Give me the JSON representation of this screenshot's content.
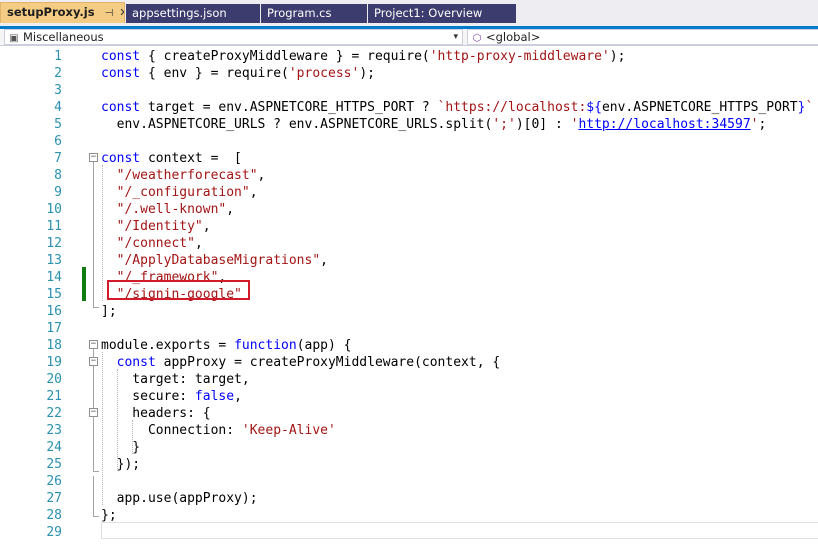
{
  "tabs": [
    {
      "label": "setupProxy.js",
      "active": true,
      "pin_icon": "pin-icon",
      "close_icon": "close-icon",
      "pin_glyph": "⊣",
      "close_glyph": "✕"
    },
    {
      "label": "appsettings.json",
      "active": false
    },
    {
      "label": "Program.cs",
      "active": false
    },
    {
      "label": "Project1: Overview",
      "active": false
    }
  ],
  "navbar": {
    "project": {
      "label": "Miscellaneous",
      "icon": "js-file-icon",
      "icon_glyph": "▣"
    },
    "scope": {
      "label": "<global>",
      "icon": "cube-icon",
      "icon_glyph": "⬡"
    },
    "arrow_glyph": "▾"
  },
  "editor": {
    "language": "javascript",
    "colors": {
      "keyword": "#0000ff",
      "string": "#a31515",
      "line_number": "#2b91af",
      "change_marker": "#107c10",
      "highlight_border": "#d11a2a",
      "active_tab": "#f5cc84"
    },
    "lines": [
      {
        "n": "1",
        "tokens": [
          {
            "t": "const",
            "c": "kw"
          },
          {
            "t": " { createProxyMiddleware } = require("
          },
          {
            "t": "'http-proxy-middleware'",
            "c": "str"
          },
          {
            "t": ");"
          }
        ]
      },
      {
        "n": "2",
        "tokens": [
          {
            "t": "const",
            "c": "kw"
          },
          {
            "t": " { env } = require("
          },
          {
            "t": "'process'",
            "c": "str"
          },
          {
            "t": ");"
          }
        ]
      },
      {
        "n": "3",
        "tokens": []
      },
      {
        "n": "4",
        "tokens": [
          {
            "t": "const",
            "c": "kw"
          },
          {
            "t": " target = env.ASPNETCORE_HTTPS_PORT ? "
          },
          {
            "t": "`https://localhost:",
            "c": "str"
          },
          {
            "t": "${",
            "c": "kw"
          },
          {
            "t": "env.ASPNETCORE_HTTPS_PORT"
          },
          {
            "t": "}",
            "c": "kw"
          },
          {
            "t": "`",
            "c": "str"
          },
          {
            "t": " :"
          }
        ]
      },
      {
        "n": "5",
        "tokens": [
          {
            "t": "  env.ASPNETCORE_URLS ? env.ASPNETCORE_URLS.split("
          },
          {
            "t": "';'",
            "c": "str"
          },
          {
            "t": ")[0] : "
          },
          {
            "t": "'",
            "c": "str"
          },
          {
            "t": "http://localhost:34597",
            "c": "url"
          },
          {
            "t": "'",
            "c": "str"
          },
          {
            "t": ";"
          }
        ]
      },
      {
        "n": "6",
        "tokens": []
      },
      {
        "n": "7",
        "tokens": [
          {
            "t": "const",
            "c": "kw"
          },
          {
            "t": " context =  ["
          }
        ]
      },
      {
        "n": "8",
        "tokens": [
          {
            "t": "  "
          },
          {
            "t": "\"/weatherforecast\"",
            "c": "str"
          },
          {
            "t": ","
          }
        ]
      },
      {
        "n": "9",
        "tokens": [
          {
            "t": "  "
          },
          {
            "t": "\"/_configuration\"",
            "c": "str"
          },
          {
            "t": ","
          }
        ]
      },
      {
        "n": "10",
        "tokens": [
          {
            "t": "  "
          },
          {
            "t": "\"/.well-known\"",
            "c": "str"
          },
          {
            "t": ","
          }
        ]
      },
      {
        "n": "11",
        "tokens": [
          {
            "t": "  "
          },
          {
            "t": "\"/Identity\"",
            "c": "str"
          },
          {
            "t": ","
          }
        ]
      },
      {
        "n": "12",
        "tokens": [
          {
            "t": "  "
          },
          {
            "t": "\"/connect\"",
            "c": "str"
          },
          {
            "t": ","
          }
        ]
      },
      {
        "n": "13",
        "tokens": [
          {
            "t": "  "
          },
          {
            "t": "\"/ApplyDatabaseMigrations\"",
            "c": "str"
          },
          {
            "t": ","
          }
        ]
      },
      {
        "n": "14",
        "tokens": [
          {
            "t": "  "
          },
          {
            "t": "\"/_framework\"",
            "c": "str"
          },
          {
            "t": ","
          }
        ]
      },
      {
        "n": "15",
        "tokens": [
          {
            "t": "  "
          },
          {
            "t": "\"/signin-google\"",
            "c": "str"
          }
        ]
      },
      {
        "n": "16",
        "tokens": [
          {
            "t": "];"
          }
        ]
      },
      {
        "n": "17",
        "tokens": []
      },
      {
        "n": "18",
        "tokens": [
          {
            "t": "module.exports = "
          },
          {
            "t": "function",
            "c": "kw"
          },
          {
            "t": "(app) {"
          }
        ]
      },
      {
        "n": "19",
        "tokens": [
          {
            "t": "  "
          },
          {
            "t": "const",
            "c": "kw"
          },
          {
            "t": " appProxy = createProxyMiddleware(context, {"
          }
        ]
      },
      {
        "n": "20",
        "tokens": [
          {
            "t": "    target: target,"
          }
        ]
      },
      {
        "n": "21",
        "tokens": [
          {
            "t": "    secure: "
          },
          {
            "t": "false",
            "c": "kw"
          },
          {
            "t": ","
          }
        ]
      },
      {
        "n": "22",
        "tokens": [
          {
            "t": "    headers: {"
          }
        ]
      },
      {
        "n": "23",
        "tokens": [
          {
            "t": "      Connection: "
          },
          {
            "t": "'Keep-Alive'",
            "c": "str"
          }
        ]
      },
      {
        "n": "24",
        "tokens": [
          {
            "t": "    }"
          }
        ]
      },
      {
        "n": "25",
        "tokens": [
          {
            "t": "  });"
          }
        ]
      },
      {
        "n": "26",
        "tokens": []
      },
      {
        "n": "27",
        "tokens": [
          {
            "t": "  app.use(appProxy);"
          }
        ]
      },
      {
        "n": "28",
        "tokens": [
          {
            "t": "};"
          }
        ]
      },
      {
        "n": "29",
        "tokens": []
      }
    ]
  }
}
